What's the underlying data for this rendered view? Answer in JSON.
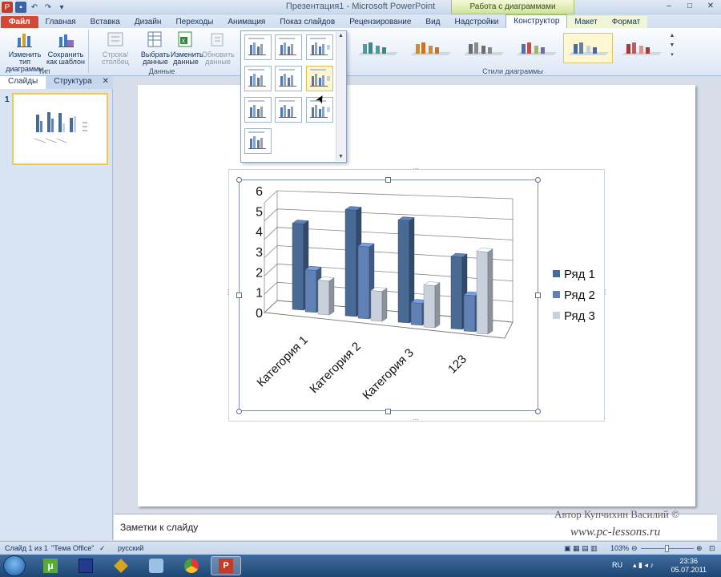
{
  "window": {
    "title": "Презентация1 - Microsoft PowerPoint",
    "context_header": "Работа с диаграммами",
    "controls": [
      "–",
      "□",
      "✕"
    ]
  },
  "tabs": [
    {
      "label": "Файл",
      "kind": "file"
    },
    {
      "label": "Главная"
    },
    {
      "label": "Вставка"
    },
    {
      "label": "Дизайн"
    },
    {
      "label": "Переходы"
    },
    {
      "label": "Анимация"
    },
    {
      "label": "Показ слайдов"
    },
    {
      "label": "Рецензирование"
    },
    {
      "label": "Вид"
    },
    {
      "label": "Надстройки"
    },
    {
      "label": "Конструктор",
      "kind": "active"
    },
    {
      "label": "Макет",
      "kind": "ctx"
    },
    {
      "label": "Формат",
      "kind": "ctx"
    }
  ],
  "ribbon": {
    "type_group": {
      "label": "Тип",
      "change_type_line1": "Изменить тип",
      "change_type_line2": "диаграммы",
      "save_template_line1": "Сохранить",
      "save_template_line2": "как шаблон"
    },
    "data_group": {
      "label": "Данные",
      "row_col": "Строка/столбец",
      "select_line1": "Выбрать",
      "select_line2": "данные",
      "edit_line1": "Изменить",
      "edit_line2": "данные",
      "refresh_line1": "Обновить",
      "refresh_line2": "данные"
    },
    "styles_group": {
      "label": "Стили диаграммы"
    }
  },
  "slides_pane": {
    "tab_slides": "Слайды",
    "tab_outline": "Структура",
    "close": "✕",
    "slide_number": "1"
  },
  "chart_data": {
    "type": "bar",
    "categories": [
      "Категория 1",
      "Категория 2",
      "Категория 3",
      "123"
    ],
    "series": [
      {
        "name": "Ряд 1",
        "values": [
          4.3,
          5.3,
          5.1,
          3.6
        ],
        "color": "#4a6a96"
      },
      {
        "name": "Ряд 2",
        "values": [
          2.1,
          3.6,
          1.1,
          1.8
        ],
        "color": "#6081b6"
      },
      {
        "name": "Ряд 3",
        "values": [
          1.7,
          1.5,
          2.1,
          4.1
        ],
        "color": "#c8d0dc"
      }
    ],
    "yticks": [
      "0",
      "1",
      "2",
      "3",
      "4",
      "5",
      "6"
    ],
    "ylim": [
      0,
      6
    ],
    "grid": true,
    "legend": "right"
  },
  "notes": {
    "placeholder": "Заметки к слайду"
  },
  "watermark": {
    "author": "Автор Купчихин Василий ©",
    "site": "www.pc-lessons.ru"
  },
  "status": {
    "slide": "Слайд 1 из 1",
    "theme": "\"Тема Office\"",
    "language": "русский",
    "zoom": "103%"
  },
  "taskbar": {
    "lang": "RU",
    "time": "23:36",
    "date": "05.07.2011"
  },
  "colors": {
    "accent": "#a9c06b",
    "file_tab": "#d34836",
    "selection": "#f2c94c"
  }
}
